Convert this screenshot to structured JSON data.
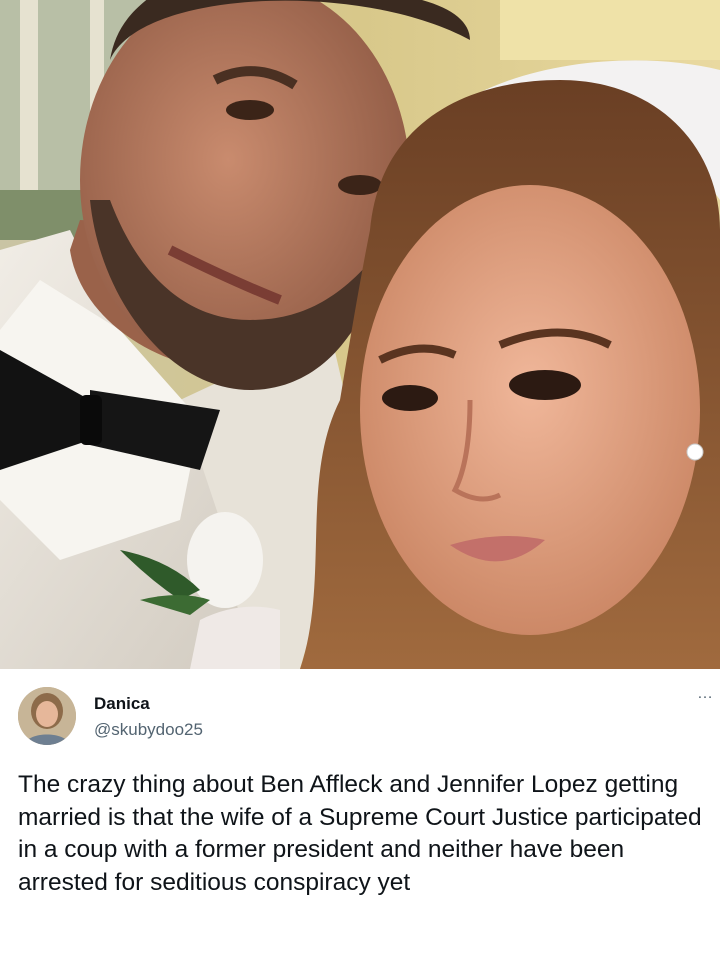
{
  "tweet": {
    "author_name": "Danica",
    "author_handle": "@skubydoo25",
    "more_icon": "…",
    "text": "The crazy thing about Ben Affleck and Jennifer Lopez getting married is that the wife of a Supreme Court Justice participated in a coup with a former president and neither have been arrested for seditious conspiracy yet"
  },
  "photo": {
    "subject": "wedding-selfie"
  },
  "colors": {
    "text_primary": "#0f1419",
    "text_secondary": "#536471",
    "background": "#ffffff"
  }
}
